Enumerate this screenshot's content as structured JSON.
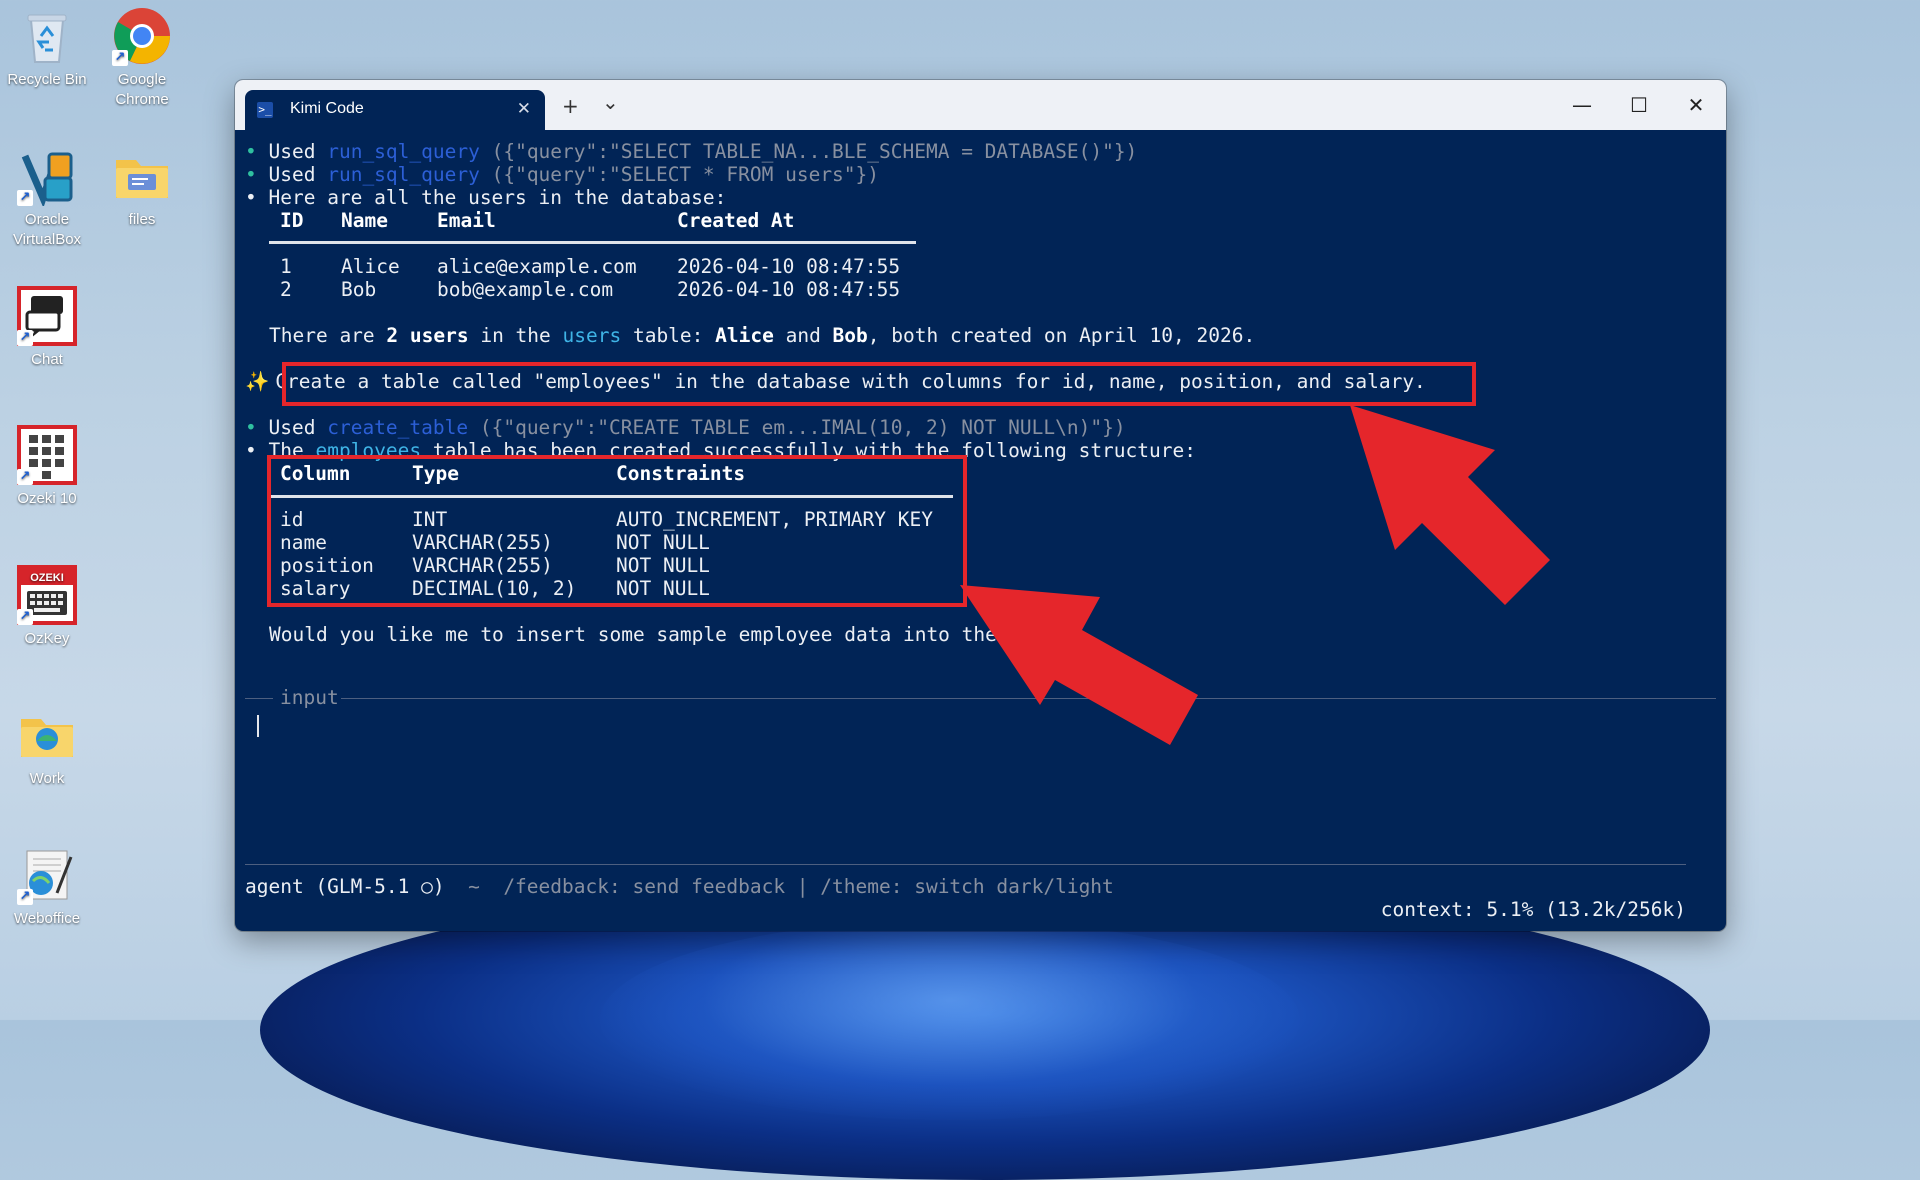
{
  "desktop": {
    "icons": [
      {
        "label": "Recycle Bin"
      },
      {
        "label": "Google Chrome"
      },
      {
        "label": "Oracle VirtualBox"
      },
      {
        "label": "files"
      },
      {
        "label": "Chat"
      },
      {
        "label": "Ozeki 10"
      },
      {
        "label": "OzKey"
      },
      {
        "label": "Work"
      },
      {
        "label": "Weboffice"
      }
    ]
  },
  "window": {
    "tab_title": "Kimi Code",
    "new_tab_symbol": "+",
    "dropdown_symbol": "⌄",
    "close_tab_symbol": "✕",
    "minimize_symbol": "—",
    "maximize_symbol": "☐",
    "close_symbol": "✕"
  },
  "terminal": {
    "bullet": "•",
    "sparkle": "✨",
    "tool_calls": [
      {
        "prefix": "Used",
        "tool": "run_sql_query",
        "args": "({\"query\":\"SELECT TABLE_NA...BLE_SCHEMA = DATABASE()\"})"
      },
      {
        "prefix": "Used",
        "tool": "run_sql_query",
        "args": "({\"query\":\"SELECT * FROM users\"})"
      },
      {
        "prefix": "Used",
        "tool": "create_table",
        "args": "({\"query\":\"CREATE TABLE em...IMAL(10, 2) NOT NULL\\n)\"})"
      }
    ],
    "users_intro": "Here are all the users in the database:",
    "users_table": {
      "headers": [
        "ID",
        "Name",
        "Email",
        "Created At"
      ],
      "rows": [
        [
          "1",
          "Alice",
          "alice@example.com",
          "2026-04-10 08:47:55"
        ],
        [
          "2",
          "Bob",
          "bob@example.com",
          "2026-04-10 08:47:55"
        ]
      ]
    },
    "summary": {
      "p1": "There are ",
      "count": "2 users",
      "p2": " in the ",
      "table": "users",
      "p3": " table: ",
      "name1": "Alice",
      "p4": " and ",
      "name2": "Bob",
      "p5": ", both created on April 10, 2026."
    },
    "prompt": "Create a table called \"employees\" in the database with columns for id, name, position, and salary.",
    "result_intro": {
      "p1": "The ",
      "table": "employees",
      "p2": " table has been created successfully with the following structure:"
    },
    "schema_table": {
      "headers": [
        "Column",
        "Type",
        "Constraints"
      ],
      "rows": [
        [
          "id",
          "INT",
          "AUTO_INCREMENT, PRIMARY KEY"
        ],
        [
          "name",
          "VARCHAR(255)",
          "NOT NULL"
        ],
        [
          "position",
          "VARCHAR(255)",
          "NOT NULL"
        ],
        [
          "salary",
          "DECIMAL(10, 2)",
          "NOT NULL"
        ]
      ]
    },
    "followup": "Would you like me to insert some sample employee data into the table?",
    "input_label": "input",
    "status": {
      "agent": "agent (GLM-5.1 ○)",
      "sep": "~",
      "hints": "/feedback: send feedback | /theme: switch dark/light",
      "context": "context: 5.1% (13.2k/256k)"
    }
  },
  "colors": {
    "terminal_bg": "#012456",
    "highlight_red": "#e5262b",
    "tool_blue": "#2c5fd6",
    "bullet_green": "#2fc0a0"
  }
}
